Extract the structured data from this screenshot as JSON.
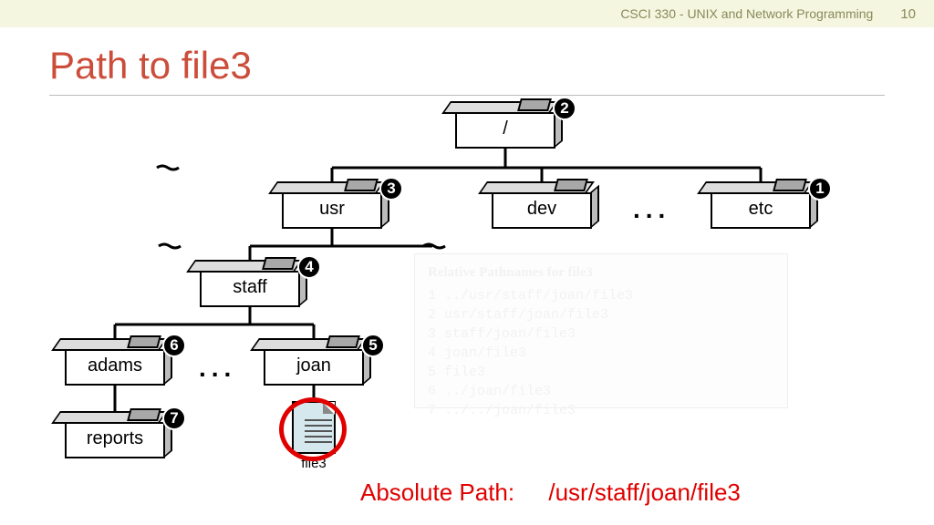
{
  "header": {
    "course": "CSCI 330 - UNIX and Network Programming",
    "page_number": "10"
  },
  "title": "Path to file3",
  "tree": {
    "root": {
      "label": "/",
      "badge": "2"
    },
    "usr": {
      "label": "usr",
      "badge": "3"
    },
    "dev": {
      "label": "dev"
    },
    "etc": {
      "label": "etc",
      "badge": "1"
    },
    "staff": {
      "label": "staff",
      "badge": "4"
    },
    "adams": {
      "label": "adams",
      "badge": "6"
    },
    "joan": {
      "label": "joan",
      "badge": "5"
    },
    "reports": {
      "label": "reports",
      "badge": "7"
    },
    "file3": {
      "label": "file3"
    },
    "ellipsis": "..."
  },
  "relative_box": {
    "heading": "Relative Pathnames for file3",
    "rows": [
      "1  ../usr/staff/joan/file3",
      "2  usr/staff/joan/file3",
      "3  staff/joan/file3",
      "4  joan/file3",
      "5  file3",
      "6  ../joan/file3",
      "7  ../../joan/file3"
    ]
  },
  "absolute": {
    "label": "Absolute Path:",
    "value": "/usr/staff/joan/file3"
  }
}
